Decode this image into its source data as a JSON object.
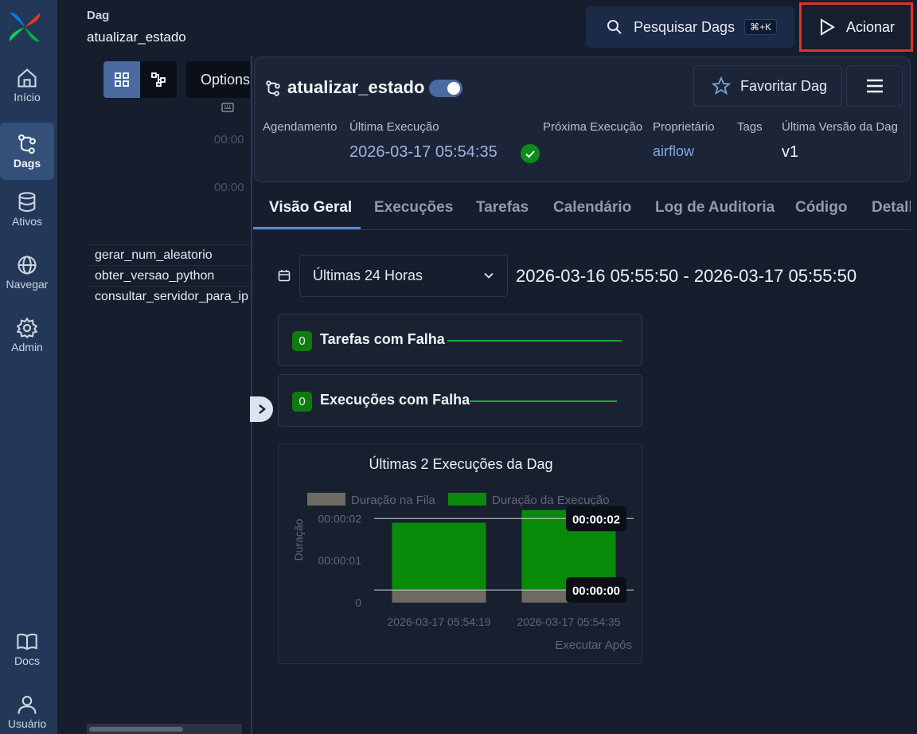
{
  "nav": {
    "items": [
      {
        "label": "Início",
        "icon": "home-icon"
      },
      {
        "label": "Dags",
        "icon": "dags-icon"
      },
      {
        "label": "Ativos",
        "icon": "database-icon"
      },
      {
        "label": "Navegar",
        "icon": "globe-icon"
      },
      {
        "label": "Admin",
        "icon": "gear-icon"
      },
      {
        "label": "Docs",
        "icon": "book-icon"
      },
      {
        "label": "Usuário",
        "icon": "user-icon"
      }
    ]
  },
  "left_panel": {
    "dag_label": "Dag",
    "dag_name": "atualizar_estado",
    "options_label": "Options",
    "time_ticks": [
      "00:00",
      "00:00"
    ],
    "tasks": [
      "gerar_num_aleatorio",
      "obter_versao_python",
      "consultar_servidor_para_ip"
    ]
  },
  "topbar": {
    "search_label": "Pesquisar Dags",
    "search_shortcut": "⌘+K",
    "trigger_label": "Acionar"
  },
  "header": {
    "title": "atualizar_estado",
    "favorite_label": "Favoritar Dag",
    "meta": {
      "schedule_label": "Agendamento",
      "last_run_label": "Última Execução",
      "last_run_value": "2026-03-17 05:54:35",
      "next_run_label": "Próxima Execução",
      "owner_label": "Proprietário",
      "owner_value": "airflow",
      "tags_label": "Tags",
      "version_label": "Última Versão da Dag",
      "version_value": "v1"
    }
  },
  "tabs": [
    "Visão Geral",
    "Execuções",
    "Tarefas",
    "Calendário",
    "Log de Auditoria",
    "Código",
    "Detalhes"
  ],
  "overview": {
    "range_select": "Últimas 24 Horas",
    "range_text": "2026-03-16 05:55:50 - 2026-03-17 05:55:50",
    "failed_tasks": {
      "count": "0",
      "label": "Tarefas com Falha"
    },
    "failed_runs": {
      "count": "0",
      "label": "Execuções com Falha"
    }
  },
  "colors": {
    "accent": "#4a6aa0",
    "success": "#0f7a10",
    "queue_bar": "#6e6a63",
    "run_bar": "#0a8a0a",
    "highlight": "#e03127"
  },
  "chart_data": {
    "type": "bar",
    "title": "Últimas 2 Execuções da Dag",
    "categories": [
      "2026-03-17 05:54:19",
      "2026-03-17 05:54:35"
    ],
    "series": [
      {
        "name": "Duração na Fila",
        "values": [
          0.3,
          0.3
        ]
      },
      {
        "name": "Duração da Execução",
        "values": [
          1.6,
          1.9
        ]
      }
    ],
    "ylabel": "Duração",
    "xlabel": "Executar Após",
    "y_ticks": [
      "0",
      "00:00:01",
      "00:00:02"
    ],
    "ylim": [
      0,
      2.1
    ],
    "reference_lines": [
      {
        "value": 2,
        "label": "00:00:02"
      },
      {
        "value": 0.3,
        "label": "00:00:00"
      }
    ],
    "legend": "top"
  }
}
